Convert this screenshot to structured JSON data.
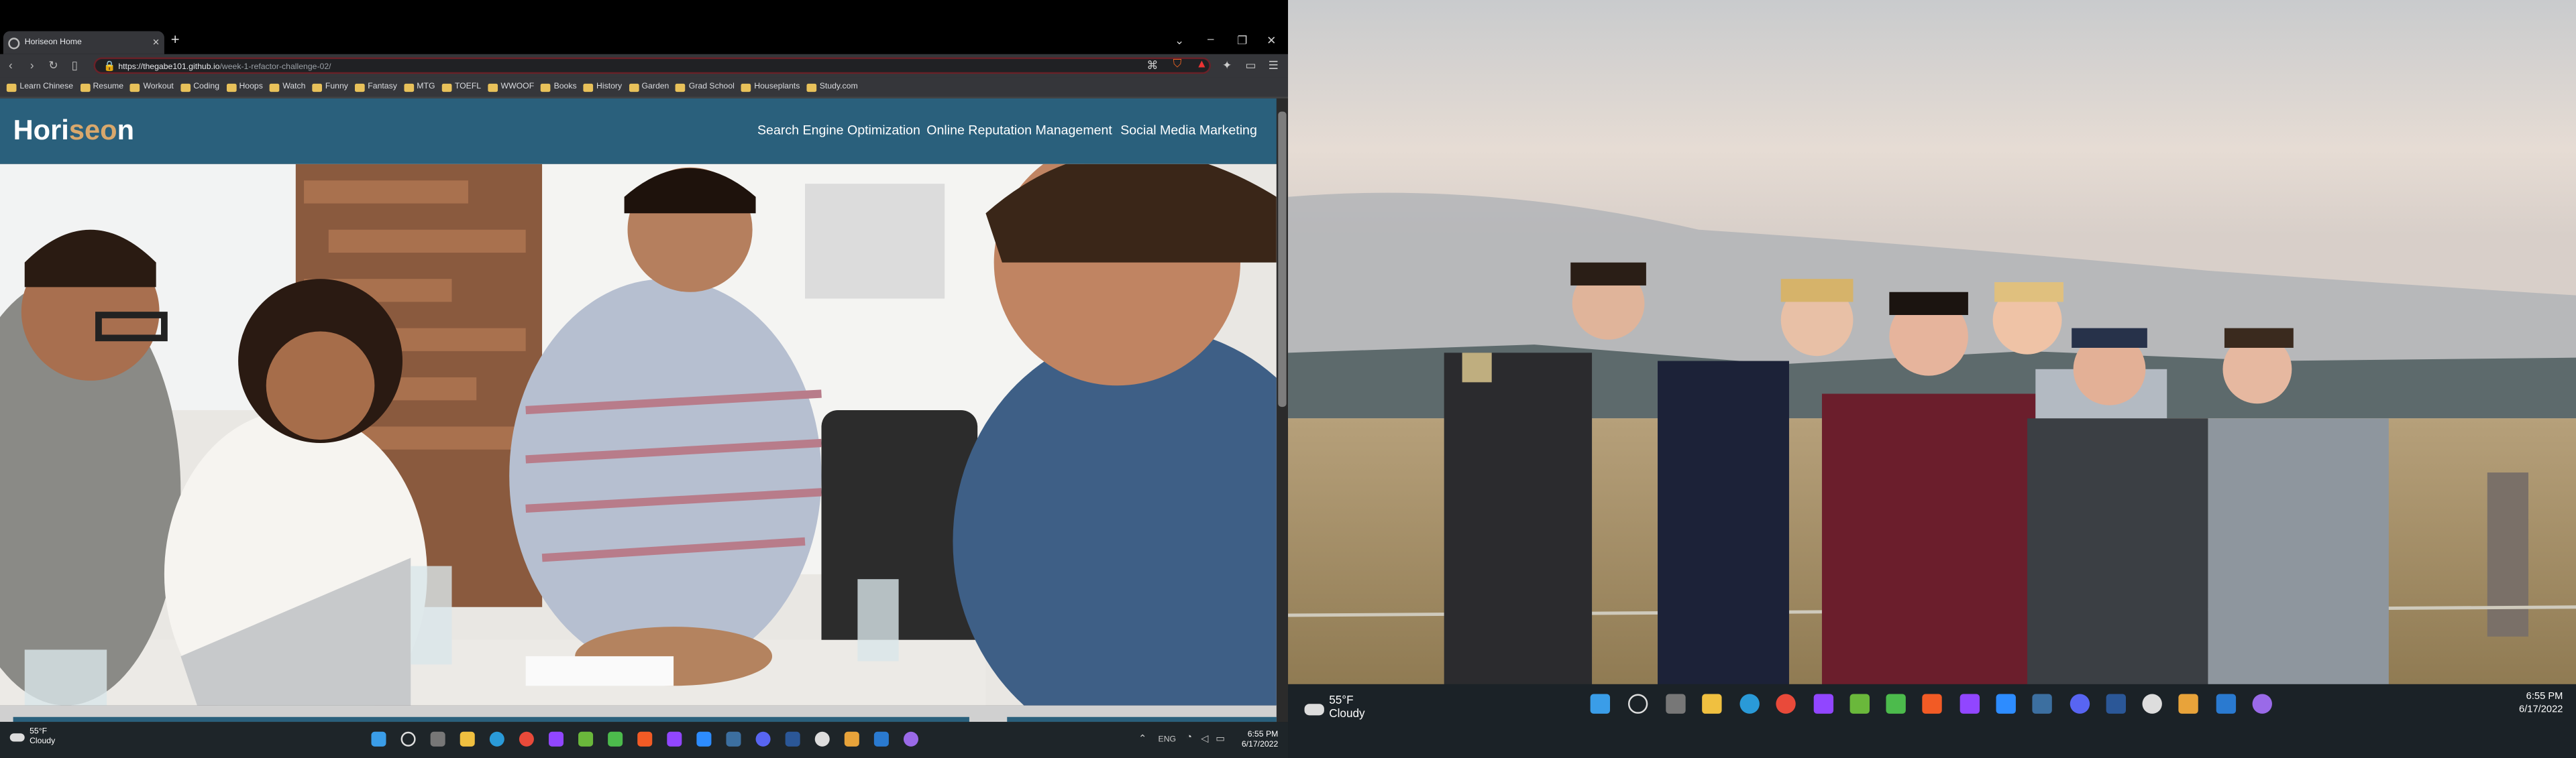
{
  "browser": {
    "tab_title": "Horiseon Home",
    "url_host": "https://thegabe101.github.io",
    "url_path": "/week-1-refactor-challenge-02/",
    "bookmarks": [
      "Learn Chinese",
      "Resume",
      "Workout",
      "Coding",
      "Hoops",
      "Watch",
      "Funny",
      "Fantasy",
      "MTG",
      "TOEFL",
      "WWOOF",
      "Books",
      "History",
      "Garden",
      "Grad School",
      "Houseplants",
      "Study.com"
    ]
  },
  "site": {
    "logo_part1": "Hori",
    "logo_part2": "seo",
    "logo_part3": "n",
    "nav": [
      "Search Engine Optimization",
      "Online Reputation Management",
      "Social Media Marketing"
    ]
  },
  "taskbar_left": {
    "temp": "55°F",
    "condition": "Cloudy",
    "lang": "ENG",
    "time": "6:55 PM",
    "date": "6/17/2022"
  },
  "taskbar_right": {
    "temp": "55°F",
    "condition": "Cloudy",
    "time": "6:55 PM",
    "date": "6/17/2022"
  },
  "colors": {
    "header": "#2a607c",
    "logo_accent": "#d9a86c",
    "taskbar": "#1e2529"
  }
}
